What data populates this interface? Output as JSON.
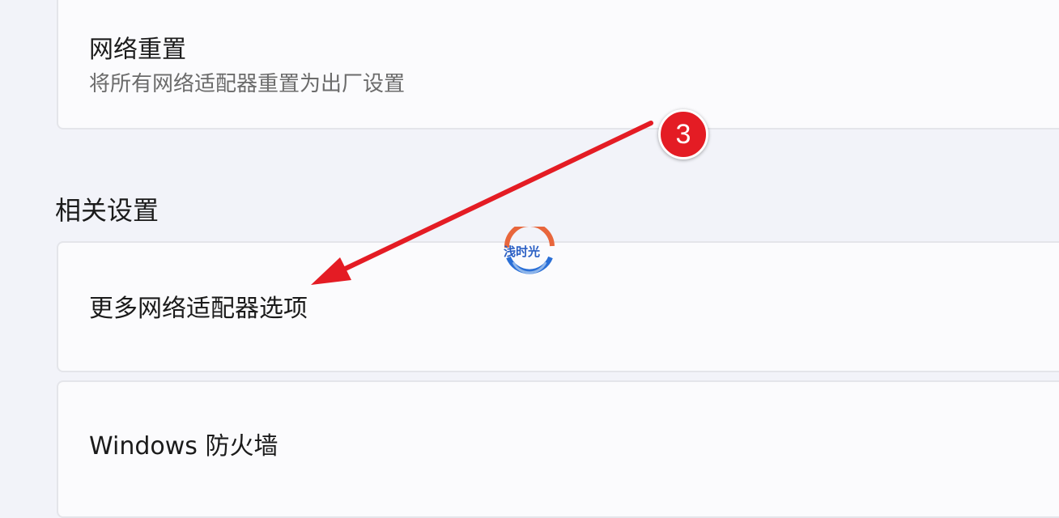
{
  "network_reset": {
    "title": "网络重置",
    "description": "将所有网络适配器重置为出厂设置"
  },
  "related_settings": {
    "heading": "相关设置",
    "items": [
      {
        "label": "更多网络适配器选项"
      },
      {
        "label": "Windows 防火墙"
      }
    ]
  },
  "annotation": {
    "step_number": "3",
    "color": "#e41c24"
  },
  "watermark": {
    "text": "浅时光",
    "icon": "watermark-logo-icon"
  }
}
